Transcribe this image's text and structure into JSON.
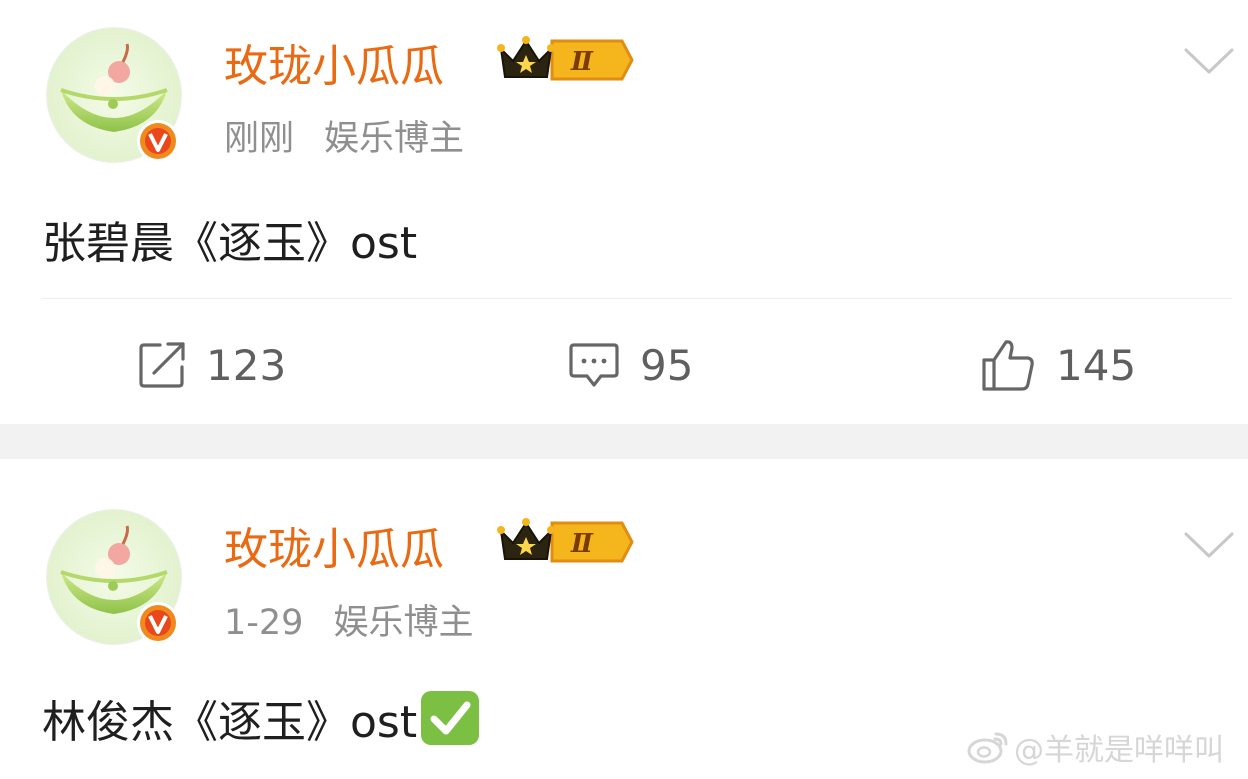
{
  "posts": [
    {
      "username": "玫珑小瓜瓜",
      "vip_level": "Ⅱ",
      "time": "刚刚",
      "tag": "娱乐博主",
      "content": "张碧晨《逐玉》ost",
      "actions": {
        "repost": "123",
        "comment": "95",
        "like": "145"
      }
    },
    {
      "username": "玫珑小瓜瓜",
      "vip_level": "Ⅱ",
      "time": "1-29",
      "tag": "娱乐博主",
      "content": "林俊杰《逐玉》ost"
    }
  ],
  "watermark": "@羊就是咩咩叫",
  "colors": {
    "username": "#e96a12",
    "meta": "#8f8f8f",
    "action": "#5f5f5f",
    "separator": "#f2f2f2"
  },
  "icons": [
    "melon-avatar",
    "verified-v-icon",
    "crown-vip-icon",
    "chevron-down-icon",
    "repost-icon",
    "comment-icon",
    "like-icon",
    "check-mark-emoji",
    "weibo-logo-icon"
  ]
}
